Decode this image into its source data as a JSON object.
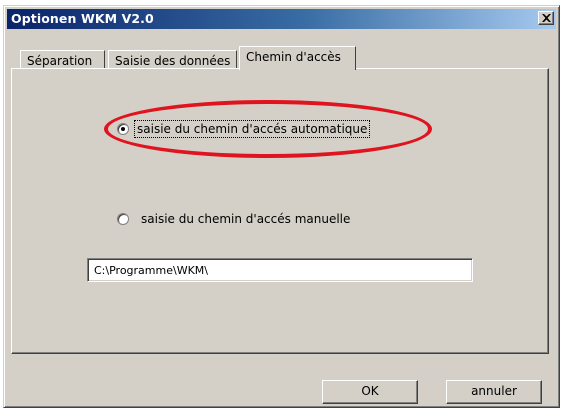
{
  "window": {
    "title": "Optionen WKM V2.0",
    "close_symbol": "×"
  },
  "tabs": [
    {
      "label": "Séparation",
      "active": false
    },
    {
      "label": "Saisie des données",
      "active": false
    },
    {
      "label": "Chemin d'accès",
      "active": true
    }
  ],
  "path_options": {
    "automatic_label": "saisie du  chemin d'accés automatique",
    "manual_label": "saisie du  chemin d'accés manuelle",
    "selected": "automatic"
  },
  "path_field": {
    "value": "C:\\Programme\\WKM\\"
  },
  "buttons": {
    "ok": "OK",
    "cancel": "annuler"
  },
  "annotation": {
    "color": "#e0141e"
  }
}
